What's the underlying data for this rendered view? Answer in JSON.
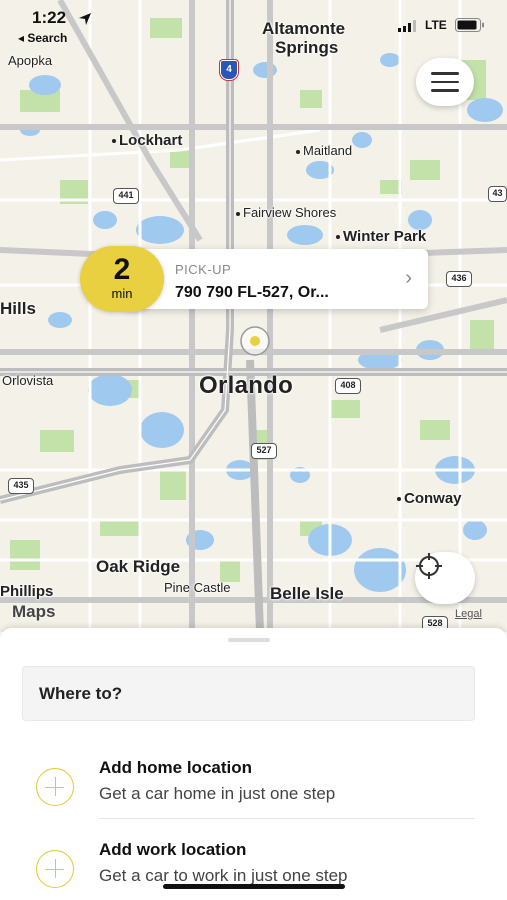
{
  "status_bar": {
    "time": "1:22",
    "back_label": "◂ Search",
    "network": "LTE"
  },
  "map": {
    "labels": {
      "altamonte": "Altamonte",
      "springs": "Springs",
      "apopka": "Apopka",
      "lockhart": "Lockhart",
      "maitland": "Maitland",
      "fairview_shores": "Fairview Shores",
      "winter_park": "Winter Park",
      "hills": "Hills",
      "orlovista": "Orlovista",
      "orlando": "Orlando",
      "conway": "Conway",
      "oak_ridge": "Oak Ridge",
      "pine_castle": "Pine Castle",
      "belle_isle": "Belle Isle",
      "phillips": "Phillips"
    },
    "route_shields": {
      "i4": "4",
      "r441": "441",
      "r436": "436",
      "r408": "408",
      "r527": "527",
      "r435": "435",
      "r528": "528",
      "r43": "43"
    },
    "brand": "Maps",
    "legal": "Legal"
  },
  "pickup": {
    "eta_value": "2",
    "eta_unit": "min",
    "label": "PICK-UP",
    "address": "790 790 FL-527, Or..."
  },
  "sheet": {
    "search_placeholder": "Where to?",
    "home": {
      "title": "Add home location",
      "subtitle": "Get a car home in just one step"
    },
    "work": {
      "title": "Add work location",
      "subtitle": "Get a car to work in just one step"
    }
  },
  "colors": {
    "accent": "#e8d040",
    "water": "#9fc9ef",
    "park": "#b8dea0",
    "road": "#c6c6c6"
  }
}
